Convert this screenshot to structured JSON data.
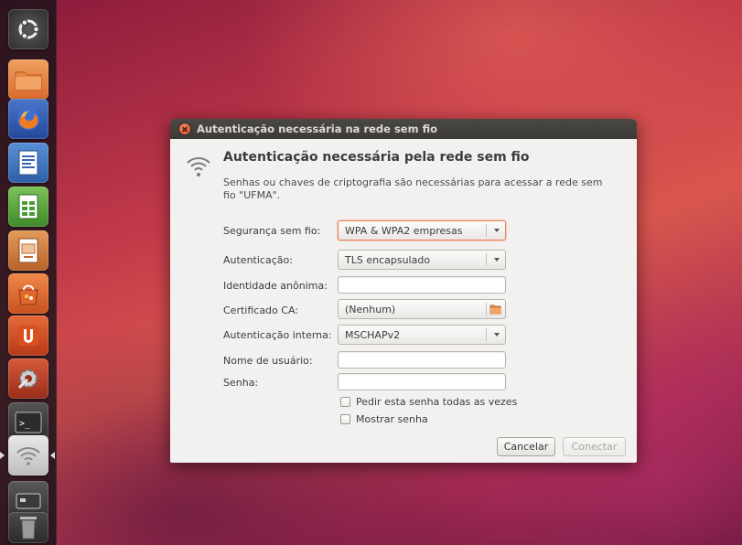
{
  "launcher": {
    "items": [
      {
        "name": "dash-home",
        "icon": "ubuntu-logo-icon"
      },
      {
        "name": "home-folder",
        "icon": "folder-icon"
      },
      {
        "name": "firefox",
        "icon": "firefox-icon"
      },
      {
        "name": "libreoffice-writer",
        "icon": "writer-icon"
      },
      {
        "name": "libreoffice-calc",
        "icon": "calc-icon"
      },
      {
        "name": "libreoffice-impress",
        "icon": "impress-icon"
      },
      {
        "name": "software-center",
        "icon": "shopping-bag-icon"
      },
      {
        "name": "ubuntu-one",
        "icon": "ubuntu-one-icon"
      },
      {
        "name": "system-settings",
        "icon": "settings-icon"
      },
      {
        "name": "terminal",
        "icon": "terminal-icon"
      },
      {
        "name": "network",
        "icon": "wifi-icon"
      },
      {
        "name": "removable-drive",
        "icon": "drive-icon"
      },
      {
        "name": "trash",
        "icon": "trash-icon"
      }
    ]
  },
  "dialog": {
    "window_title": "Autenticação necessária na rede sem fio",
    "heading": "Autenticação necessária pela rede sem fio",
    "description": "Senhas ou chaves de criptografia são necessárias para acessar a rede sem fio \"UFMA\".",
    "fields": {
      "security_label": "Segurança sem fio:",
      "security_value": "WPA & WPA2 empresas",
      "auth_label": "Autenticação:",
      "auth_value": "TLS encapsulado",
      "anon_identity_label": "Identidade anônima:",
      "anon_identity_value": "",
      "ca_cert_label": "Certificado CA:",
      "ca_cert_value": "(Nenhum)",
      "inner_auth_label": "Autenticação interna:",
      "inner_auth_value": "MSCHAPv2",
      "username_label": "Nome de usuário:",
      "username_value": "",
      "password_label": "Senha:",
      "password_value": ""
    },
    "checkboxes": {
      "ask_password_label": "Pedir esta senha todas as vezes",
      "ask_password_checked": false,
      "show_password_label": "Mostrar senha",
      "show_password_checked": false
    },
    "buttons": {
      "cancel_label": "Cancelar",
      "connect_label": "Conectar"
    }
  },
  "colors": {
    "accent": "#e9835a",
    "titlebar": "#3c3b37",
    "dialog_bg": "#f2f1f0"
  }
}
